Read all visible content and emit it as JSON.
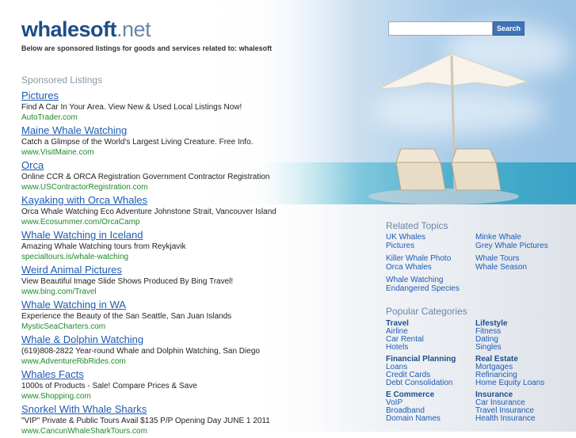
{
  "header": {
    "logo_main": "whalesoft",
    "logo_tld": ".net",
    "tagline": "Below are sponsored listings for goods and services related to: whalesoft",
    "search_button": "Search",
    "search_value": ""
  },
  "sponsored": {
    "heading": "Sponsored Listings",
    "listings": [
      {
        "title": "Pictures",
        "desc": "Find A Car In Your Area. View New & Used Local Listings Now!",
        "url": "AutoTrader.com"
      },
      {
        "title": "Maine Whale Watching",
        "desc": "Catch a Glimpse of the World's Largest Living Creature. Free Info.",
        "url": "www.VisitMaine.com"
      },
      {
        "title": "Orca",
        "desc": "Online CCR & ORCA Registration Government Contractor Registration",
        "url": "www.USContractorRegistration.com"
      },
      {
        "title": "Kayaking with Orca Whales",
        "desc": "Orca Whale Watching Eco Adventure Johnstone Strait, Vancouver Island",
        "url": "www.Ecosummer.com/OrcaCamp"
      },
      {
        "title": "Whale Watching in Iceland",
        "desc": "Amazing Whale Watching tours from Reykjavik",
        "url": "specialtours.is/whale-watching"
      },
      {
        "title": "Weird Animal Pictures",
        "desc": "View Beautiful Image Slide Shows Produced By Bing Travel!",
        "url": "www.bing.com/Travel"
      },
      {
        "title": "Whale Watching in WA",
        "desc": "Experience the Beauty of the San Seattle, San Juan Islands",
        "url": "MysticSeaCharters.com"
      },
      {
        "title": "Whale & Dolphin Watching",
        "desc": "(619)808-2822 Year-round Whale and Dolphin Watching, San Diego",
        "url": "www.AdventureRibRides.com"
      },
      {
        "title": "Whales Facts",
        "desc": "1000s of Products - Sale! Compare Prices & Save",
        "url": "www.Shopping.com"
      },
      {
        "title": "Snorkel With Whale Sharks",
        "desc": "\"VIP\" Private & Public Tours Avail $135 P/P Opening Day JUNE 1 2011",
        "url": "www.CancunWhaleSharkTours.com"
      }
    ]
  },
  "related": {
    "heading": "Related Topics",
    "left": [
      [
        "UK Whales",
        "Pictures"
      ],
      [
        "Killer Whale Photo",
        "Orca Whales"
      ],
      [
        "Whale Watching",
        "Endangered Species"
      ]
    ],
    "right": [
      [
        "Minke Whale",
        "Grey Whale Pictures"
      ],
      [
        "Whale Tours",
        "Whale Season"
      ]
    ]
  },
  "popular": {
    "heading": "Popular Categories",
    "left": [
      {
        "title": "Travel",
        "links": [
          "Airline",
          "Car Rental",
          "Hotels"
        ]
      },
      {
        "title": "Financial Planning",
        "links": [
          "Loans",
          "Credit Cards",
          "Debt Consolidation"
        ]
      },
      {
        "title": "E Commerce",
        "links": [
          "VoIP",
          "Broadband",
          "Domain Names"
        ]
      }
    ],
    "right": [
      {
        "title": "Lifestyle",
        "links": [
          "Fitness",
          "Dating",
          "Singles"
        ]
      },
      {
        "title": "Real Estate",
        "links": [
          "Mortgages",
          "Refinancing",
          "Home Equity Loans"
        ]
      },
      {
        "title": "Insurance",
        "links": [
          "Car Insurance",
          "Travel Insurance",
          "Health Insurance"
        ]
      }
    ]
  }
}
